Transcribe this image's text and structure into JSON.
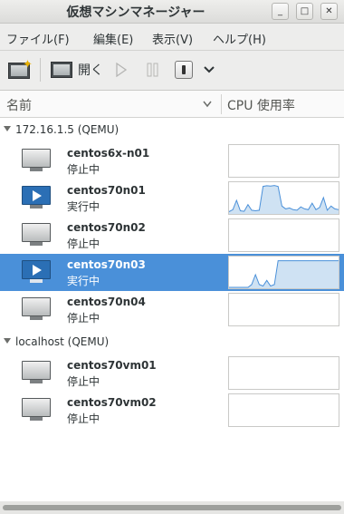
{
  "window": {
    "title": "仮想マシンマネージャー"
  },
  "menu": [
    "ファイル(F)",
    "編集(E)",
    "表示(V)",
    "ヘルプ(H)"
  ],
  "toolbar": {
    "open_label": "開く"
  },
  "columns": {
    "name": "名前",
    "cpu": "CPU 使用率"
  },
  "groups": [
    {
      "label": "172.16.1.5 (QEMU)"
    },
    {
      "label": "localhost (QEMU)"
    }
  ],
  "vms": [
    {
      "name": "centos6x-n01",
      "status": "停止中",
      "running": false,
      "selected": false,
      "cpu": []
    },
    {
      "name": "centos70n01",
      "status": "実行中",
      "running": true,
      "selected": false,
      "cpu": [
        0.05,
        0.12,
        0.45,
        0.08,
        0.06,
        0.3,
        0.1,
        0.08,
        0.1,
        0.95,
        0.97,
        0.96,
        0.98,
        0.95,
        0.25,
        0.15,
        0.18,
        0.12,
        0.1,
        0.22,
        0.15,
        0.12,
        0.35,
        0.12,
        0.2,
        0.55,
        0.1,
        0.25,
        0.15,
        0.12
      ]
    },
    {
      "name": "centos70n02",
      "status": "停止中",
      "running": false,
      "selected": false,
      "cpu": []
    },
    {
      "name": "centos70n03",
      "status": "実行中",
      "running": true,
      "selected": true,
      "cpu": [
        0,
        0,
        0,
        0,
        0,
        0,
        0.1,
        0.45,
        0.1,
        0.05,
        0.25,
        0.05,
        0.1,
        0.95,
        0.95,
        0.95,
        0.95,
        0.95,
        0.95,
        0.95,
        0.95,
        0.95,
        0.95,
        0.95,
        0.95,
        0.95,
        0.95,
        0.95,
        0.95,
        0.95
      ]
    },
    {
      "name": "centos70n04",
      "status": "停止中",
      "running": false,
      "selected": false,
      "cpu": []
    },
    {
      "name": "centos70vm01",
      "status": "停止中",
      "running": false,
      "selected": false,
      "cpu": []
    },
    {
      "name": "centos70vm02",
      "status": "停止中",
      "running": false,
      "selected": false,
      "cpu": []
    }
  ],
  "icons": {
    "new_vm": "new-vm-icon",
    "open": "monitor-icon",
    "run": "play-icon",
    "pause": "pause-icon",
    "shutdown": "shutdown-icon",
    "dropdown": "chevron-down-icon"
  }
}
